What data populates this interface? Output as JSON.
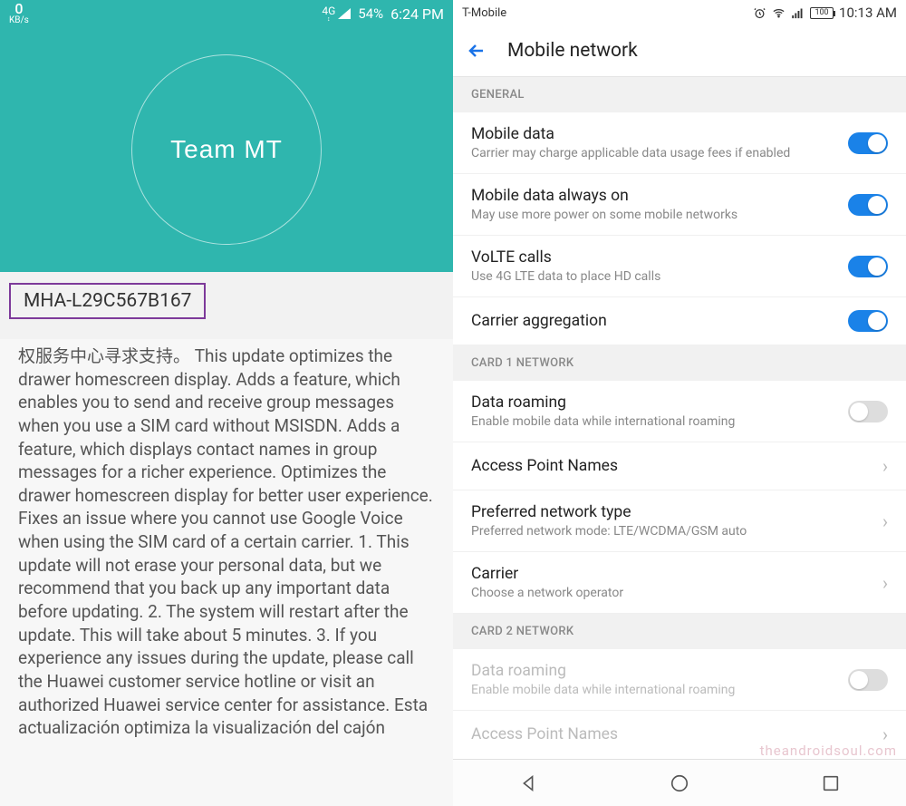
{
  "left": {
    "status": {
      "kbps_value": "0",
      "kbps_label": "KB/s",
      "net_label": "4G",
      "battery": "54%",
      "time": "6:24 PM"
    },
    "logo": "Team MT",
    "version": "MHA-L29C567B167",
    "body_text": "权服务中心寻求支持。 This update optimizes the drawer homescreen display. Adds a feature, which enables you to send and receive group messages when you use a SIM card without MSISDN. Adds a feature, which displays contact names in group messages for a richer experience. Optimizes the drawer homescreen display for better user experience. Fixes an issue where you cannot use Google Voice when using the SIM card of a certain carrier. 1. This update will not erase your personal data, but we recommend that you back up any important data before updating. 2. The system will restart after the update. This will take about 5 minutes. 3. If you experience any issues during the update, please call the Huawei customer service hotline or visit an authorized Huawei service center for assistance. Esta actualización optimiza la visualización del cajón"
  },
  "right": {
    "status": {
      "carrier": "T-Mobile",
      "battery": "100",
      "time": "10:13 AM"
    },
    "page_title": "Mobile network",
    "sections": {
      "general": {
        "header": "GENERAL",
        "mobile_data": {
          "title": "Mobile data",
          "sub": "Carrier may charge applicable data usage fees if enabled",
          "on": true
        },
        "always_on": {
          "title": "Mobile data always on",
          "sub": "May use more power on some mobile networks",
          "on": true
        },
        "volte": {
          "title": "VoLTE calls",
          "sub": "Use 4G LTE data to place HD calls",
          "on": true
        },
        "carrier_agg": {
          "title": "Carrier aggregation",
          "on": true
        }
      },
      "card1": {
        "header": "CARD 1 NETWORK",
        "roaming": {
          "title": "Data roaming",
          "sub": "Enable mobile data while international roaming",
          "on": false
        },
        "apn": {
          "title": "Access Point Names"
        },
        "pref_net": {
          "title": "Preferred network type",
          "sub": "Preferred network mode: LTE/WCDMA/GSM auto"
        },
        "carrier": {
          "title": "Carrier",
          "sub": "Choose a network operator"
        }
      },
      "card2": {
        "header": "CARD 2 NETWORK",
        "roaming": {
          "title": "Data roaming",
          "sub": "Enable mobile data while international roaming",
          "on": false
        },
        "apn": {
          "title": "Access Point Names"
        }
      }
    },
    "watermark": "theandroidsoul.com"
  }
}
